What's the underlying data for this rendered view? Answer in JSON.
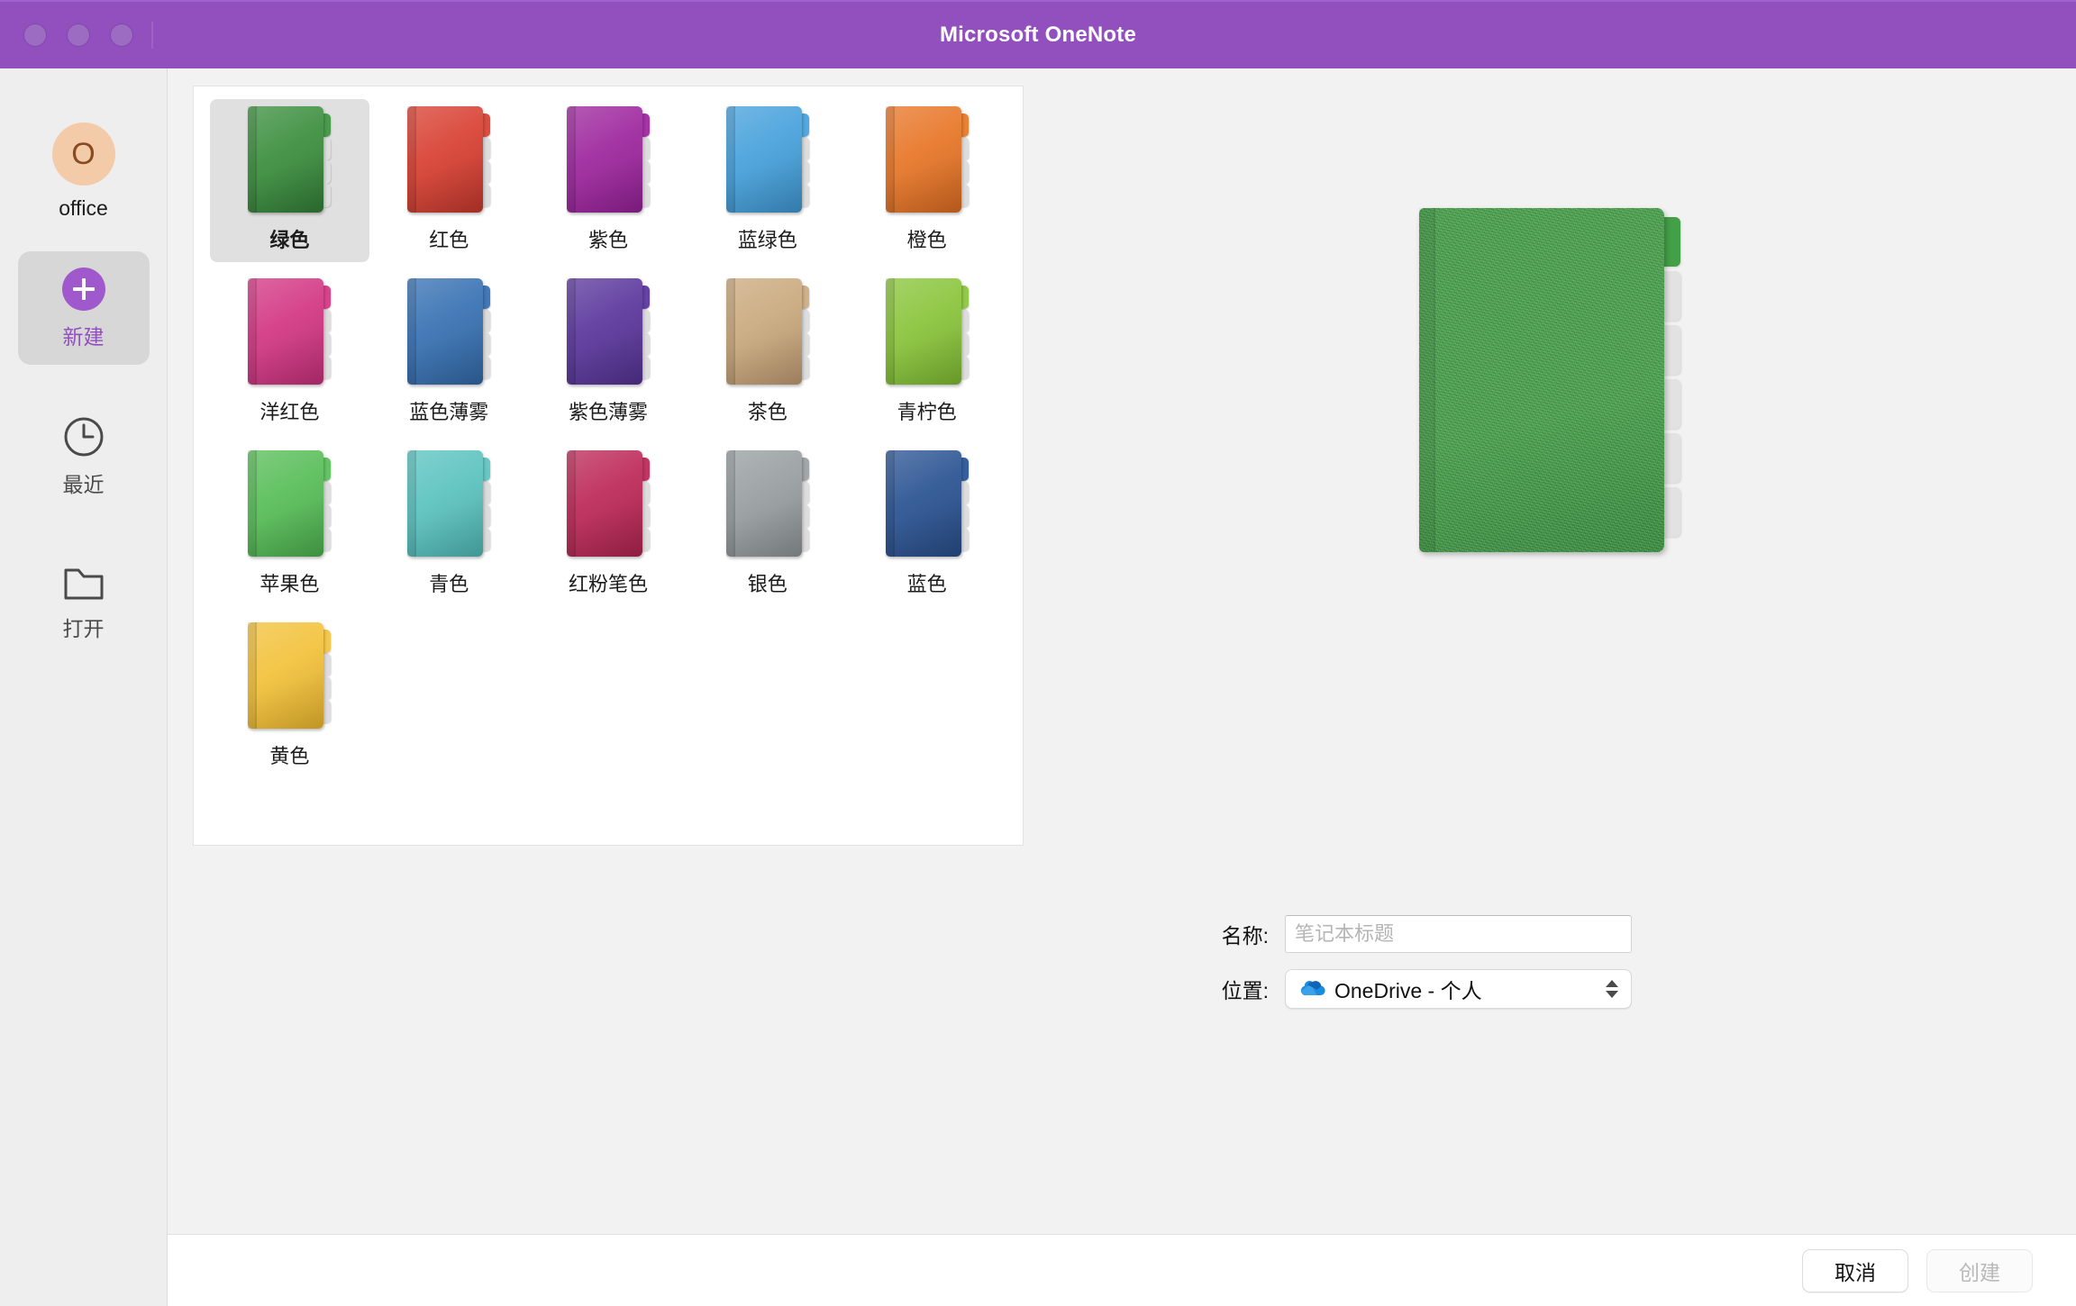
{
  "window": {
    "title": "Microsoft OneNote",
    "traffic_lights": [
      "close",
      "minimize",
      "zoom"
    ]
  },
  "sidebar": {
    "account": {
      "initial": "O",
      "name": "office"
    },
    "items": [
      {
        "label": "新建",
        "icon": "plus-circle-icon",
        "selected": true
      },
      {
        "label": "最近",
        "icon": "clock-icon",
        "selected": false
      },
      {
        "label": "打开",
        "icon": "folder-icon",
        "selected": false
      }
    ]
  },
  "gallery": {
    "selected_index": 0,
    "swatches": [
      {
        "label": "绿色",
        "color": "#3f9142",
        "dark": "#2f7533",
        "tab": "#4a9c4d"
      },
      {
        "label": "红色",
        "color": "#d94436",
        "dark": "#b8352a",
        "tab": "#dd4d3f"
      },
      {
        "label": "紫色",
        "color": "#a02ba0",
        "dark": "#8a1f8c",
        "tab": "#a634a6"
      },
      {
        "label": "蓝绿色",
        "color": "#4aa3dc",
        "dark": "#3a8cc2",
        "tab": "#52a9e0"
      },
      {
        "label": "橙色",
        "color": "#e8792c",
        "dark": "#cc6520",
        "tab": "#ea8134"
      },
      {
        "label": "洋红色",
        "color": "#d43b86",
        "dark": "#b82d72",
        "tab": "#d8448c"
      },
      {
        "label": "蓝色薄雾",
        "color": "#3b74b4",
        "dark": "#2f629c",
        "tab": "#4179ba"
      },
      {
        "label": "紫色薄雾",
        "color": "#5e3b9e",
        "dark": "#4e2f88",
        "tab": "#6642a6"
      },
      {
        "label": "茶色",
        "color": "#cbab80",
        "dark": "#b2906a",
        "tab": "#d0b189"
      },
      {
        "label": "青柠色",
        "color": "#8cc63f",
        "dark": "#76ad2f",
        "tab": "#93ca4a"
      },
      {
        "label": "苹果色",
        "color": "#5bbf5b",
        "dark": "#47a449",
        "tab": "#63c463"
      },
      {
        "label": "青色",
        "color": "#5ec4c0",
        "dark": "#4aacaa",
        "tab": "#67c9c5"
      },
      {
        "label": "红粉笔色",
        "color": "#be2d5c",
        "dark": "#a2224c",
        "tab": "#c33664"
      },
      {
        "label": "银色",
        "color": "#9aa0a3",
        "dark": "#848a8d",
        "tab": "#a1a7aa"
      },
      {
        "label": "蓝色",
        "color": "#2f5795",
        "dark": "#264880",
        "tab": "#35609f"
      },
      {
        "label": "黄色",
        "color": "#f3c33f",
        "dark": "#dcac2a",
        "tab": "#f4c84d"
      }
    ]
  },
  "preview": {
    "color": "#43a047",
    "tab_count": 6
  },
  "form": {
    "name_label": "名称:",
    "name_value": "",
    "name_placeholder": "笔记本标题",
    "location_label": "位置:",
    "location_value": "OneDrive - 个人",
    "location_icon": "onedrive-cloud-icon"
  },
  "footer": {
    "cancel_label": "取消",
    "create_label": "创建",
    "create_disabled": true
  }
}
